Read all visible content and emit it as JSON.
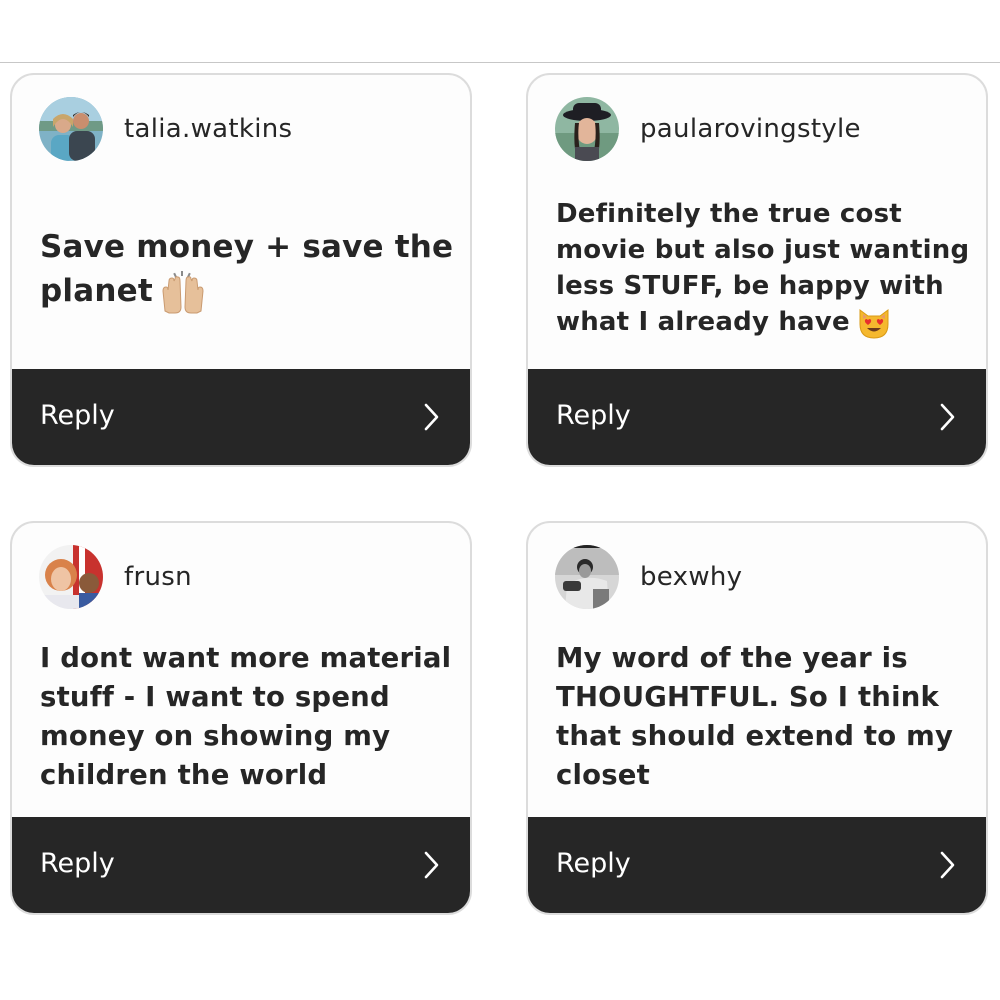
{
  "cards": [
    {
      "username": "talia.watkins",
      "comment": "Save money + save the planet",
      "emoji": "raising-hands-icon",
      "reply_label": "Reply",
      "chevron": "chevron-right-icon"
    },
    {
      "username": "paularovingstyle",
      "comment": "Definitely the true cost movie but also just wanting less STUFF, be happy with what I already have",
      "emoji": "heart-eyes-cat-icon",
      "reply_label": "Reply",
      "chevron": "chevron-right-icon"
    },
    {
      "username": "frusn",
      "comment": "I dont want more material stuff - I want to spend money on showing my children the world",
      "reply_label": "Reply",
      "chevron": "chevron-right-icon"
    },
    {
      "username": "bexwhy",
      "comment": "My word of the year is THOUGHTFUL. So I think that should extend to my closet",
      "reply_label": "Reply",
      "chevron": "chevron-right-icon"
    }
  ],
  "colors": {
    "text": "#262626",
    "reply_bar": "#262626",
    "card_border": "#dcdcdc",
    "card_bg": "#fdfdfd"
  }
}
